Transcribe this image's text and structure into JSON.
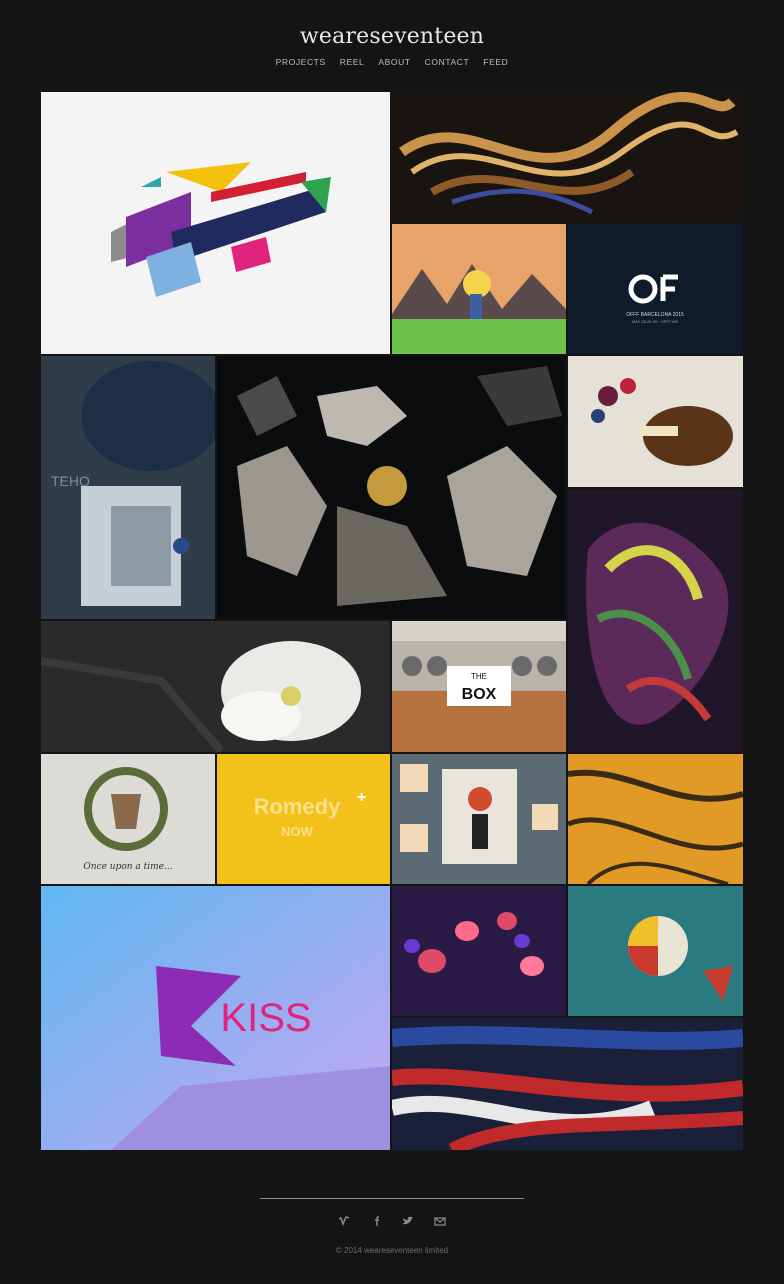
{
  "site": {
    "logo": "weareseventeen"
  },
  "nav": {
    "items": [
      "PROJECTS",
      "REEL",
      "ABOUT",
      "CONTACT",
      "FEED"
    ]
  },
  "tiles": {
    "offf_title": "OFFF BARCELONA 2015",
    "offf_dates": "MAY 28.29.30 · OFFF.WS",
    "romedy_line1": "Romedy",
    "romedy_line2": "NOW",
    "tale_caption": "Once upon a time...",
    "box_label1": "THE",
    "box_label2": "BOX",
    "kiss_label": "KISS",
    "astro_text": "TEHO"
  },
  "footer": {
    "social_icons": [
      "vimeo-icon",
      "facebook-icon",
      "twitter-icon",
      "mail-icon"
    ],
    "copyright": "© 2014 weareseventeen limited"
  }
}
